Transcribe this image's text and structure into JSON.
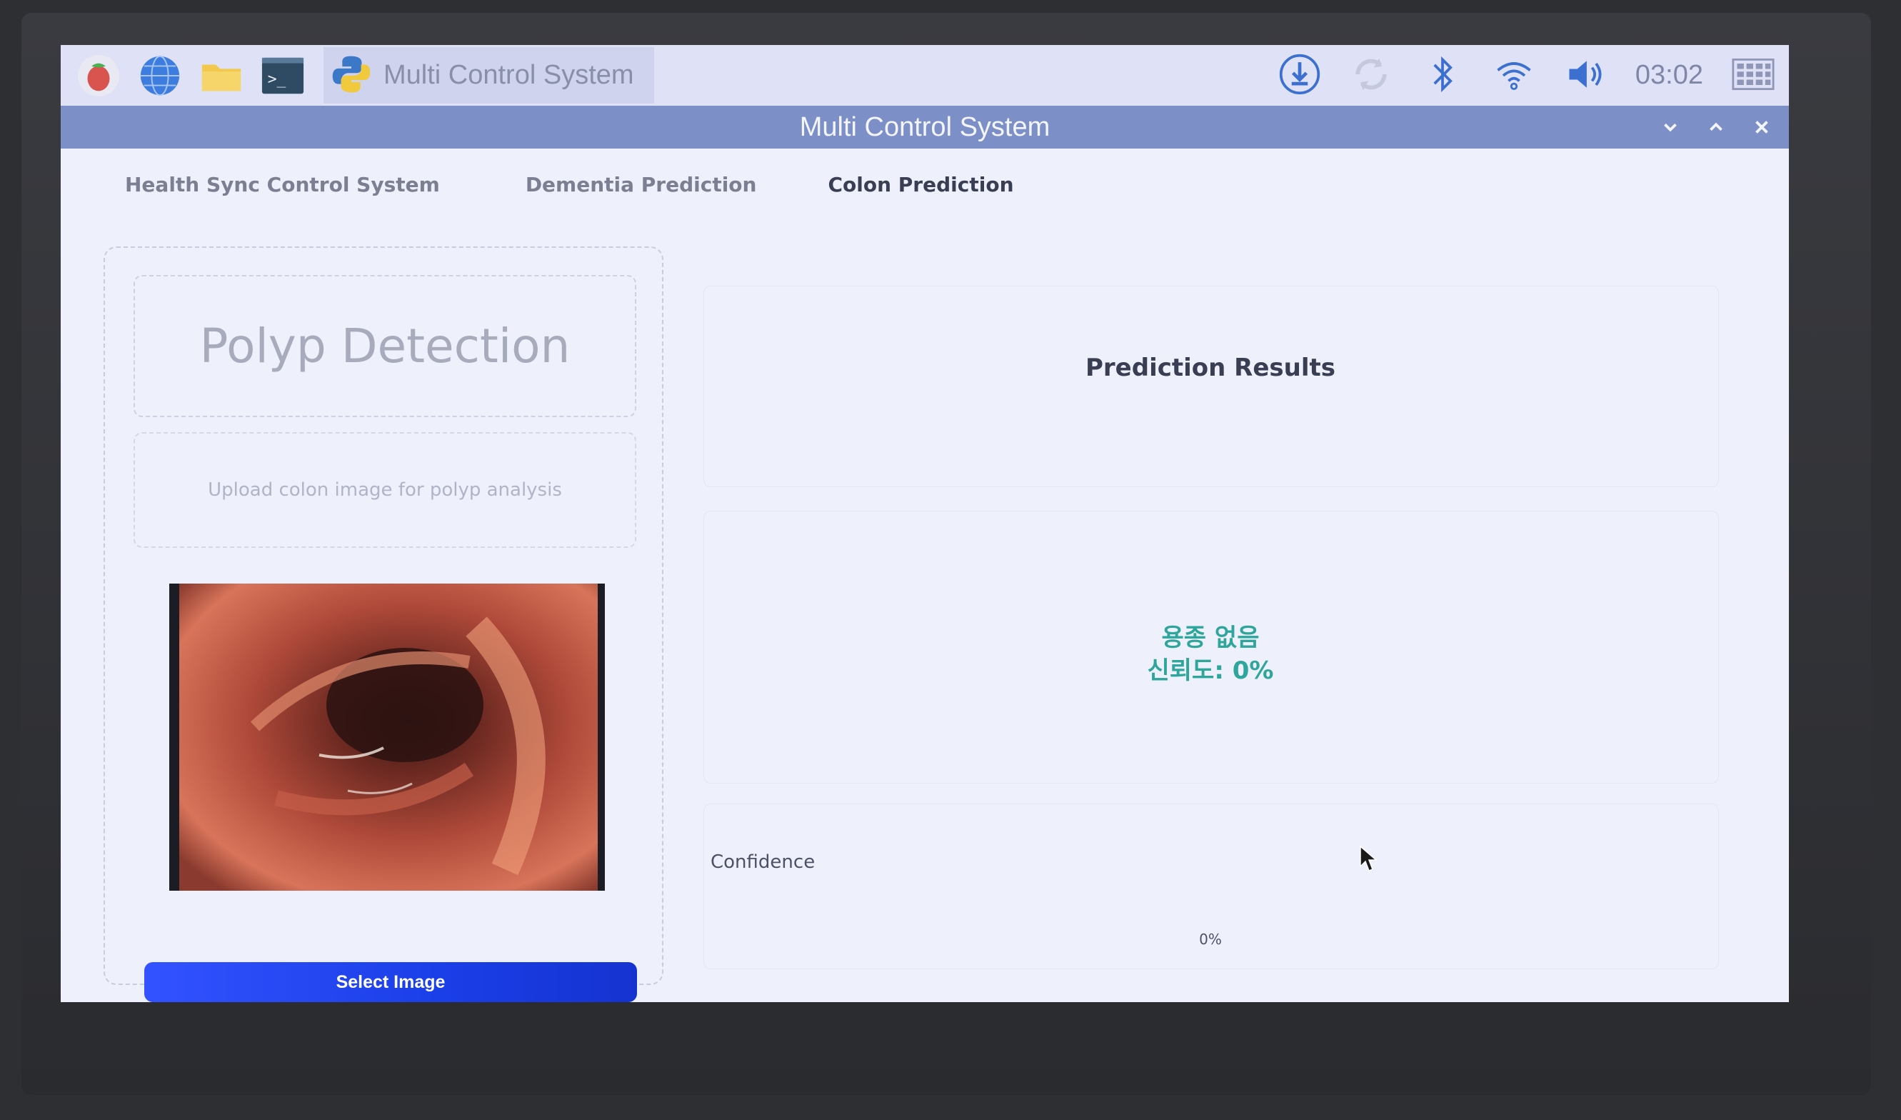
{
  "taskbar": {
    "icons": [
      "raspberry-menu-icon",
      "browser-globe-icon",
      "file-manager-icon",
      "terminal-icon"
    ],
    "app_button": {
      "icon": "python-icon",
      "label": "Multi Control System"
    },
    "tray": [
      "download-icon",
      "sync-icon",
      "bluetooth-icon",
      "wifi-icon",
      "volume-icon"
    ],
    "clock": "03:02",
    "grid_icon": "app-grid-icon"
  },
  "window": {
    "title": "Multi Control System"
  },
  "tabs": [
    {
      "label": "Health Sync Control System",
      "active": false
    },
    {
      "label": "Dementia Prediction",
      "active": false
    },
    {
      "label": "Colon Prediction",
      "active": true
    }
  ],
  "left": {
    "title": "Polyp Detection",
    "hint": "Upload colon image for polyp analysis",
    "image_alt": "colonoscopy-image",
    "select_button": "Select Image"
  },
  "right": {
    "title": "Prediction Results",
    "result_line1": "용종 없음",
    "result_line2": "신뢰도: 0%",
    "confidence_label": "Confidence",
    "confidence_value": "0%",
    "confidence_fraction": 0.0
  },
  "colors": {
    "accent_blue": "#2347ff",
    "result_teal": "#2fa69b",
    "titlebar": "#7d8fc7"
  }
}
